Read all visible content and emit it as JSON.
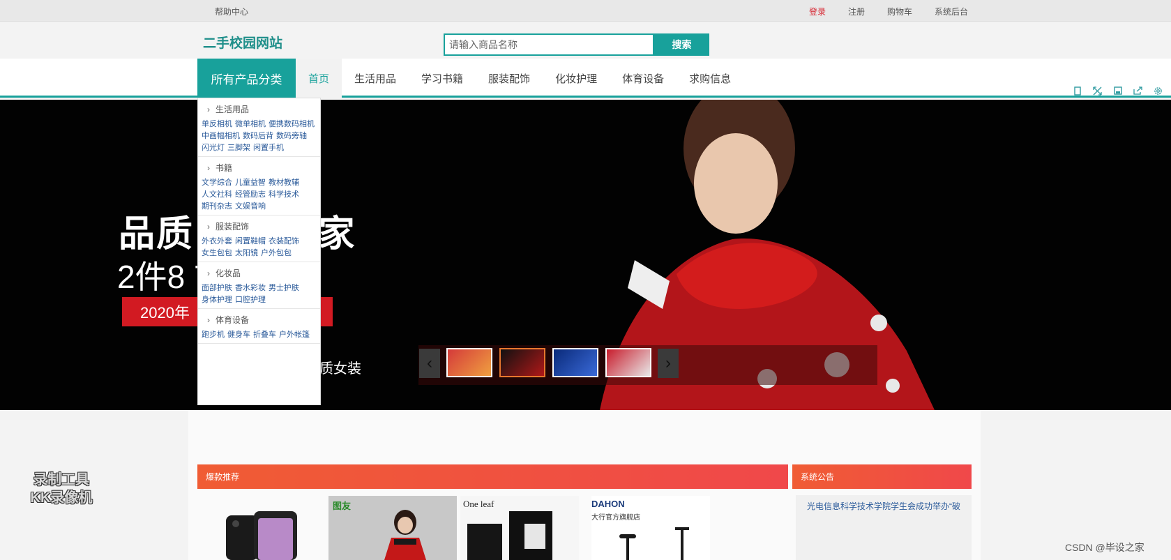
{
  "topbar": {
    "help": "帮助中心",
    "login": "登录",
    "register": "注册",
    "cart": "购物车",
    "admin": "系统后台"
  },
  "header": {
    "logo": "二手校园网站",
    "search_placeholder": "请输入商品名称",
    "search_button": "搜索"
  },
  "nav": {
    "all_categories": "所有产品分类",
    "items": [
      "首页",
      "生活用品",
      "学习书籍",
      "服装配饰",
      "化妆护理",
      "体育设备",
      "求购信息"
    ]
  },
  "categories": [
    {
      "title": "生活用品",
      "links": [
        "单反相机",
        "微单相机",
        "便携数码相机",
        "中画幅相机",
        "数码后背",
        "数码旁轴",
        "闪光灯",
        "三脚架",
        "闲置手机"
      ]
    },
    {
      "title": "书籍",
      "links": [
        "文学综合",
        "儿童益智",
        "教材教辅",
        "人文社科",
        "经管励志",
        "科学技术",
        "期刊杂志",
        "文娱音响"
      ]
    },
    {
      "title": "服装配饰",
      "links": [
        "外衣外套",
        "闲置鞋帽",
        "衣装配饰",
        "女生包包",
        "太阳镜",
        "户外包包"
      ]
    },
    {
      "title": "化妆品",
      "links": [
        "面部护肤",
        "香水彩妆",
        "男士护肤",
        "身体护理",
        "口腔护理"
      ]
    },
    {
      "title": "体育设备",
      "links": [
        "跑步机",
        "健身车",
        "折叠车",
        "户外帐篷"
      ]
    }
  ],
  "banner": {
    "headline": "品质 年货到家",
    "subline": "2件8 7折",
    "tag": "2020年",
    "caption": "质女装",
    "colors": {
      "scarf": "#d31c1c",
      "bg": "#020202"
    }
  },
  "sections": {
    "hot": "爆款推荐",
    "notice": "系统公告",
    "notice_item": "光电信息科学技术学院学生会成功举办“破"
  },
  "products": [
    {
      "brand": ""
    },
    {
      "brand": "图友"
    },
    {
      "brand": "One leaf"
    },
    {
      "brand": "DAHON"
    },
    {
      "brand": "大行官方旗舰店"
    }
  ],
  "watermark": {
    "line1": "录制工具",
    "line2": "KK录像机"
  },
  "footer_credit": "CSDN @毕设之家",
  "icons": [
    "copy-icon",
    "fullscreen-icon",
    "save-icon",
    "share-icon",
    "settings-icon"
  ]
}
